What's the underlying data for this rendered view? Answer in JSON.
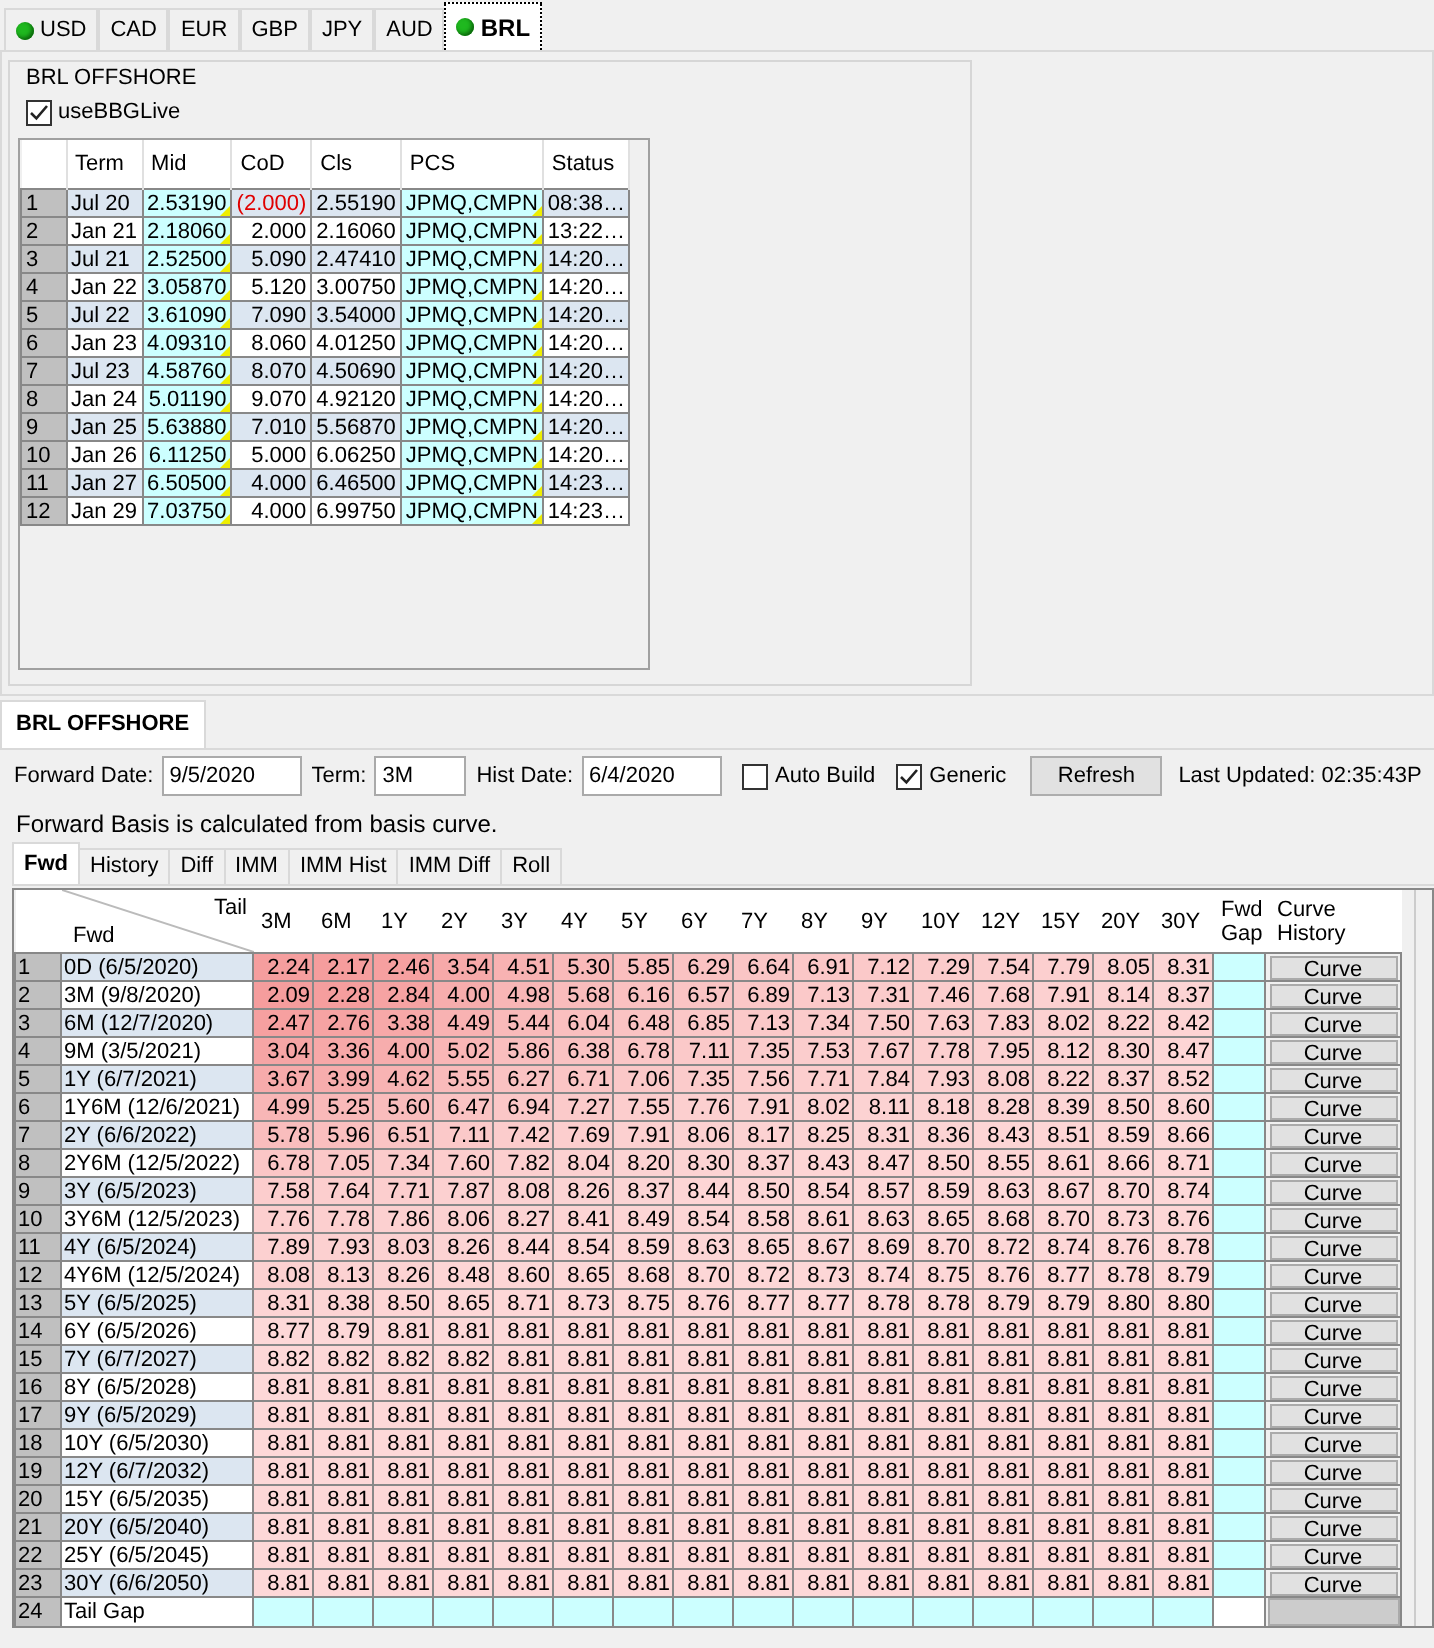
{
  "currency_tabs": [
    {
      "label": "USD",
      "live": true,
      "selected": false
    },
    {
      "label": "CAD",
      "live": false,
      "selected": false
    },
    {
      "label": "EUR",
      "live": false,
      "selected": false
    },
    {
      "label": "GBP",
      "live": false,
      "selected": false
    },
    {
      "label": "JPY",
      "live": false,
      "selected": false
    },
    {
      "label": "AUD",
      "live": false,
      "selected": false
    },
    {
      "label": "BRL",
      "live": true,
      "selected": true
    }
  ],
  "live_panel": {
    "title": "BRL OFFSHORE",
    "use_bbg": {
      "label": "useBBGLive",
      "checked": true
    },
    "columns": [
      "Term",
      "Mid",
      "CoD",
      "Cls",
      "PCS",
      "Status"
    ],
    "rows": [
      {
        "num": "1",
        "term": "Jul 20",
        "mid": "2.53190",
        "cod": "(2.000)",
        "cod_negative": true,
        "cls": "2.55190",
        "pcs": "JPMQ,CMPN",
        "status": "08:38…"
      },
      {
        "num": "2",
        "term": "Jan 21",
        "mid": "2.18060",
        "cod": "2.000",
        "cod_negative": false,
        "cls": "2.16060",
        "pcs": "JPMQ,CMPN",
        "status": "13:22…"
      },
      {
        "num": "3",
        "term": "Jul 21",
        "mid": "2.52500",
        "cod": "5.090",
        "cod_negative": false,
        "cls": "2.47410",
        "pcs": "JPMQ,CMPN",
        "status": "14:20…"
      },
      {
        "num": "4",
        "term": "Jan 22",
        "mid": "3.05870",
        "cod": "5.120",
        "cod_negative": false,
        "cls": "3.00750",
        "pcs": "JPMQ,CMPN",
        "status": "14:20…"
      },
      {
        "num": "5",
        "term": "Jul 22",
        "mid": "3.61090",
        "cod": "7.090",
        "cod_negative": false,
        "cls": "3.54000",
        "pcs": "JPMQ,CMPN",
        "status": "14:20…"
      },
      {
        "num": "6",
        "term": "Jan 23",
        "mid": "4.09310",
        "cod": "8.060",
        "cod_negative": false,
        "cls": "4.01250",
        "pcs": "JPMQ,CMPN",
        "status": "14:20…"
      },
      {
        "num": "7",
        "term": "Jul 23",
        "mid": "4.58760",
        "cod": "8.070",
        "cod_negative": false,
        "cls": "4.50690",
        "pcs": "JPMQ,CMPN",
        "status": "14:20…"
      },
      {
        "num": "8",
        "term": "Jan 24",
        "mid": "5.01190",
        "cod": "9.070",
        "cod_negative": false,
        "cls": "4.92120",
        "pcs": "JPMQ,CMPN",
        "status": "14:20…"
      },
      {
        "num": "9",
        "term": "Jan 25",
        "mid": "5.63880",
        "cod": "7.010",
        "cod_negative": false,
        "cls": "5.56870",
        "pcs": "JPMQ,CMPN",
        "status": "14:20…"
      },
      {
        "num": "10",
        "term": "Jan 26",
        "mid": "6.11250",
        "cod": "5.000",
        "cod_negative": false,
        "cls": "6.06250",
        "pcs": "JPMQ,CMPN",
        "status": "14:20…"
      },
      {
        "num": "11",
        "term": "Jan 27",
        "mid": "6.50500",
        "cod": "4.000",
        "cod_negative": false,
        "cls": "6.46500",
        "pcs": "JPMQ,CMPN",
        "status": "14:23…"
      },
      {
        "num": "12",
        "term": "Jan 29",
        "mid": "7.03750",
        "cod": "4.000",
        "cod_negative": false,
        "cls": "6.99750",
        "pcs": "JPMQ,CMPN",
        "status": "14:23…"
      }
    ]
  },
  "curve_panel": {
    "tab": "BRL OFFSHORE",
    "forward_date": {
      "label": "Forward Date:",
      "value": "9/5/2020"
    },
    "term": {
      "label": "Term:",
      "value": "3M"
    },
    "hist_date": {
      "label": "Hist Date:",
      "value": "6/4/2020"
    },
    "auto_build": {
      "label": "Auto Build",
      "checked": false
    },
    "generic": {
      "label": "Generic",
      "checked": true
    },
    "refresh_button": "Refresh",
    "last_updated": "Last Updated: 02:35:43P",
    "note": "Forward Basis is calculated from basis curve.",
    "view_tabs": [
      {
        "label": "Fwd",
        "selected": true
      },
      {
        "label": "History",
        "selected": false
      },
      {
        "label": "Diff",
        "selected": false
      },
      {
        "label": "IMM",
        "selected": false
      },
      {
        "label": "IMM Hist",
        "selected": false
      },
      {
        "label": "IMM Diff",
        "selected": false
      },
      {
        "label": "Roll",
        "selected": false
      }
    ],
    "grid": {
      "corner_tail": "Tail",
      "corner_fwd": "Fwd",
      "tails": [
        "3M",
        "6M",
        "1Y",
        "2Y",
        "3Y",
        "4Y",
        "5Y",
        "6Y",
        "7Y",
        "8Y",
        "9Y",
        "10Y",
        "12Y",
        "15Y",
        "20Y",
        "30Y"
      ],
      "gap_header": "Fwd Gap",
      "history_header": "Curve History",
      "rows": [
        {
          "num": "1",
          "kind": "curve",
          "fwd": "0D (6/5/2020)",
          "button": "Curve",
          "values": [
            "2.24",
            "2.17",
            "2.46",
            "3.54",
            "4.51",
            "5.30",
            "5.85",
            "6.29",
            "6.64",
            "6.91",
            "7.12",
            "7.29",
            "7.54",
            "7.79",
            "8.05",
            "8.31"
          ]
        },
        {
          "num": "2",
          "kind": "curve",
          "fwd": "3M (9/8/2020)",
          "button": "Curve",
          "values": [
            "2.09",
            "2.28",
            "2.84",
            "4.00",
            "4.98",
            "5.68",
            "6.16",
            "6.57",
            "6.89",
            "7.13",
            "7.31",
            "7.46",
            "7.68",
            "7.91",
            "8.14",
            "8.37"
          ]
        },
        {
          "num": "3",
          "kind": "curve",
          "fwd": "6M (12/7/2020)",
          "button": "Curve",
          "values": [
            "2.47",
            "2.76",
            "3.38",
            "4.49",
            "5.44",
            "6.04",
            "6.48",
            "6.85",
            "7.13",
            "7.34",
            "7.50",
            "7.63",
            "7.83",
            "8.02",
            "8.22",
            "8.42"
          ]
        },
        {
          "num": "4",
          "kind": "curve",
          "fwd": "9M (3/5/2021)",
          "button": "Curve",
          "values": [
            "3.04",
            "3.36",
            "4.00",
            "5.02",
            "5.86",
            "6.38",
            "6.78",
            "7.11",
            "7.35",
            "7.53",
            "7.67",
            "7.78",
            "7.95",
            "8.12",
            "8.30",
            "8.47"
          ]
        },
        {
          "num": "5",
          "kind": "curve",
          "fwd": "1Y (6/7/2021)",
          "button": "Curve",
          "values": [
            "3.67",
            "3.99",
            "4.62",
            "5.55",
            "6.27",
            "6.71",
            "7.06",
            "7.35",
            "7.56",
            "7.71",
            "7.84",
            "7.93",
            "8.08",
            "8.22",
            "8.37",
            "8.52"
          ]
        },
        {
          "num": "6",
          "kind": "curve",
          "fwd": "1Y6M (12/6/2021)",
          "button": "Curve",
          "values": [
            "4.99",
            "5.25",
            "5.60",
            "6.47",
            "6.94",
            "7.27",
            "7.55",
            "7.76",
            "7.91",
            "8.02",
            "8.11",
            "8.18",
            "8.28",
            "8.39",
            "8.50",
            "8.60"
          ]
        },
        {
          "num": "7",
          "kind": "curve",
          "fwd": "2Y (6/6/2022)",
          "button": "Curve",
          "values": [
            "5.78",
            "5.96",
            "6.51",
            "7.11",
            "7.42",
            "7.69",
            "7.91",
            "8.06",
            "8.17",
            "8.25",
            "8.31",
            "8.36",
            "8.43",
            "8.51",
            "8.59",
            "8.66"
          ]
        },
        {
          "num": "8",
          "kind": "curve",
          "fwd": "2Y6M (12/5/2022)",
          "button": "Curve",
          "values": [
            "6.78",
            "7.05",
            "7.34",
            "7.60",
            "7.82",
            "8.04",
            "8.20",
            "8.30",
            "8.37",
            "8.43",
            "8.47",
            "8.50",
            "8.55",
            "8.61",
            "8.66",
            "8.71"
          ]
        },
        {
          "num": "9",
          "kind": "curve",
          "fwd": "3Y (6/5/2023)",
          "button": "Curve",
          "values": [
            "7.58",
            "7.64",
            "7.71",
            "7.87",
            "8.08",
            "8.26",
            "8.37",
            "8.44",
            "8.50",
            "8.54",
            "8.57",
            "8.59",
            "8.63",
            "8.67",
            "8.70",
            "8.74"
          ]
        },
        {
          "num": "10",
          "kind": "curve",
          "fwd": "3Y6M (12/5/2023)",
          "button": "Curve",
          "values": [
            "7.76",
            "7.78",
            "7.86",
            "8.06",
            "8.27",
            "8.41",
            "8.49",
            "8.54",
            "8.58",
            "8.61",
            "8.63",
            "8.65",
            "8.68",
            "8.70",
            "8.73",
            "8.76"
          ]
        },
        {
          "num": "11",
          "kind": "curve",
          "fwd": "4Y (6/5/2024)",
          "button": "Curve",
          "values": [
            "7.89",
            "7.93",
            "8.03",
            "8.26",
            "8.44",
            "8.54",
            "8.59",
            "8.63",
            "8.65",
            "8.67",
            "8.69",
            "8.70",
            "8.72",
            "8.74",
            "8.76",
            "8.78"
          ]
        },
        {
          "num": "12",
          "kind": "curve",
          "fwd": "4Y6M (12/5/2024)",
          "button": "Curve",
          "values": [
            "8.08",
            "8.13",
            "8.26",
            "8.48",
            "8.60",
            "8.65",
            "8.68",
            "8.70",
            "8.72",
            "8.73",
            "8.74",
            "8.75",
            "8.76",
            "8.77",
            "8.78",
            "8.79"
          ]
        },
        {
          "num": "13",
          "kind": "curve",
          "fwd": "5Y (6/5/2025)",
          "button": "Curve",
          "values": [
            "8.31",
            "8.38",
            "8.50",
            "8.65",
            "8.71",
            "8.73",
            "8.75",
            "8.76",
            "8.77",
            "8.77",
            "8.78",
            "8.78",
            "8.79",
            "8.79",
            "8.80",
            "8.80"
          ]
        },
        {
          "num": "14",
          "kind": "curve",
          "fwd": "6Y (6/5/2026)",
          "button": "Curve",
          "values": [
            "8.77",
            "8.79",
            "8.81",
            "8.81",
            "8.81",
            "8.81",
            "8.81",
            "8.81",
            "8.81",
            "8.81",
            "8.81",
            "8.81",
            "8.81",
            "8.81",
            "8.81",
            "8.81"
          ]
        },
        {
          "num": "15",
          "kind": "curve",
          "fwd": "7Y (6/7/2027)",
          "button": "Curve",
          "values": [
            "8.82",
            "8.82",
            "8.82",
            "8.82",
            "8.81",
            "8.81",
            "8.81",
            "8.81",
            "8.81",
            "8.81",
            "8.81",
            "8.81",
            "8.81",
            "8.81",
            "8.81",
            "8.81"
          ]
        },
        {
          "num": "16",
          "kind": "curve",
          "fwd": "8Y (6/5/2028)",
          "button": "Curve",
          "values": [
            "8.81",
            "8.81",
            "8.81",
            "8.81",
            "8.81",
            "8.81",
            "8.81",
            "8.81",
            "8.81",
            "8.81",
            "8.81",
            "8.81",
            "8.81",
            "8.81",
            "8.81",
            "8.81"
          ]
        },
        {
          "num": "17",
          "kind": "curve",
          "fwd": "9Y (6/5/2029)",
          "button": "Curve",
          "values": [
            "8.81",
            "8.81",
            "8.81",
            "8.81",
            "8.81",
            "8.81",
            "8.81",
            "8.81",
            "8.81",
            "8.81",
            "8.81",
            "8.81",
            "8.81",
            "8.81",
            "8.81",
            "8.81"
          ]
        },
        {
          "num": "18",
          "kind": "curve",
          "fwd": "10Y (6/5/2030)",
          "button": "Curve",
          "values": [
            "8.81",
            "8.81",
            "8.81",
            "8.81",
            "8.81",
            "8.81",
            "8.81",
            "8.81",
            "8.81",
            "8.81",
            "8.81",
            "8.81",
            "8.81",
            "8.81",
            "8.81",
            "8.81"
          ]
        },
        {
          "num": "19",
          "kind": "curve",
          "fwd": "12Y (6/7/2032)",
          "button": "Curve",
          "values": [
            "8.81",
            "8.81",
            "8.81",
            "8.81",
            "8.81",
            "8.81",
            "8.81",
            "8.81",
            "8.81",
            "8.81",
            "8.81",
            "8.81",
            "8.81",
            "8.81",
            "8.81",
            "8.81"
          ]
        },
        {
          "num": "20",
          "kind": "curve",
          "fwd": "15Y (6/5/2035)",
          "button": "Curve",
          "values": [
            "8.81",
            "8.81",
            "8.81",
            "8.81",
            "8.81",
            "8.81",
            "8.81",
            "8.81",
            "8.81",
            "8.81",
            "8.81",
            "8.81",
            "8.81",
            "8.81",
            "8.81",
            "8.81"
          ]
        },
        {
          "num": "21",
          "kind": "curve",
          "fwd": "20Y (6/5/2040)",
          "button": "Curve",
          "values": [
            "8.81",
            "8.81",
            "8.81",
            "8.81",
            "8.81",
            "8.81",
            "8.81",
            "8.81",
            "8.81",
            "8.81",
            "8.81",
            "8.81",
            "8.81",
            "8.81",
            "8.81",
            "8.81"
          ]
        },
        {
          "num": "22",
          "kind": "curve",
          "fwd": "25Y (6/5/2045)",
          "button": "Curve",
          "values": [
            "8.81",
            "8.81",
            "8.81",
            "8.81",
            "8.81",
            "8.81",
            "8.81",
            "8.81",
            "8.81",
            "8.81",
            "8.81",
            "8.81",
            "8.81",
            "8.81",
            "8.81",
            "8.81"
          ]
        },
        {
          "num": "23",
          "kind": "curve",
          "fwd": "30Y (6/6/2050)",
          "button": "Curve",
          "values": [
            "8.81",
            "8.81",
            "8.81",
            "8.81",
            "8.81",
            "8.81",
            "8.81",
            "8.81",
            "8.81",
            "8.81",
            "8.81",
            "8.81",
            "8.81",
            "8.81",
            "8.81",
            "8.81"
          ]
        },
        {
          "num": "24",
          "kind": "gap",
          "fwd": "Tail Gap"
        }
      ]
    }
  }
}
